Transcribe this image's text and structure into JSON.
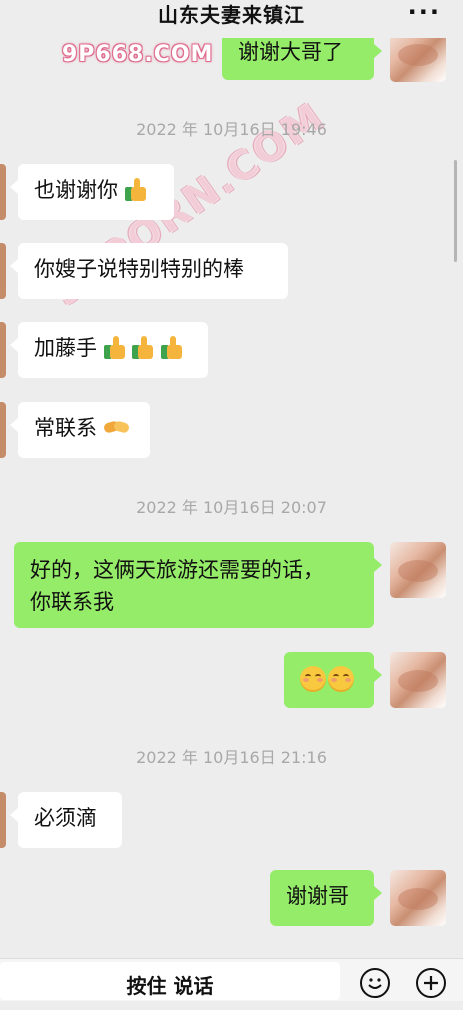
{
  "header": {
    "title": "山东夫妻来镇江",
    "more_icon": "more-dots-icon"
  },
  "watermarks": {
    "top": "9P668.COM",
    "diagonal": "91PORN.COM"
  },
  "messages": {
    "m0": {
      "text": "谢谢大哥了"
    },
    "t1": {
      "text": "2022 年 10月16日 19:46"
    },
    "m1": {
      "text": "也谢谢你",
      "emoji": "thumbs-up"
    },
    "m2": {
      "text": "你嫂子说特别特别的棒"
    },
    "m3": {
      "text": "加藤手",
      "emoji": "thumbs-up x3"
    },
    "m4": {
      "text": "常联系",
      "emoji": "handshake"
    },
    "t2": {
      "text": "2022 年 10月16日 20:07"
    },
    "m5": {
      "line1": "好的，这俩天旅游还需要的话，",
      "line2": "你联系我"
    },
    "m6": {
      "emoji": "smiling-face x2"
    },
    "t3": {
      "text": "2022 年 10月16日 21:16"
    },
    "m7": {
      "text": "必须滴"
    },
    "m8": {
      "text": "谢谢哥"
    }
  },
  "input_bar": {
    "voice_label": "按住 说话",
    "emoji_icon": "smiley-icon",
    "plus_icon": "plus-icon"
  },
  "colors": {
    "outgoing_bubble": "#95ec69",
    "incoming_bubble": "#ffffff",
    "background": "#ededed"
  }
}
